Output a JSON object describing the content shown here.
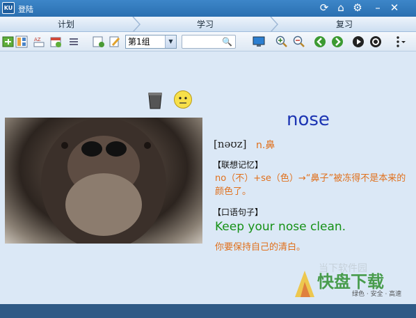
{
  "titlebar": {
    "logo": "KU",
    "title": "登陆",
    "icons": [
      "refresh-icon",
      "home-icon",
      "gear-icon",
      "minimize-icon",
      "close-icon"
    ]
  },
  "tabs": [
    {
      "label": "计划"
    },
    {
      "label": "学习"
    },
    {
      "label": "复习"
    }
  ],
  "toolbar": {
    "group_value": "第1组",
    "search_placeholder": ""
  },
  "card": {
    "word": "nose",
    "phonetic": "[nəʊz]",
    "pos": "n.鼻",
    "assoc_heading": "【联想记忆】",
    "assoc_text": "no（不）+se（色）→“鼻子”被冻得不是本来的颜色了。",
    "sentence_heading": "【口语句子】",
    "sentence_en": "Keep your nose clean.",
    "sentence_zh": "你要保持自己的清白。"
  },
  "watermark": {
    "main": "快盘下载",
    "tagline": "绿色 · 安全 · 高速",
    "faint": "当下软件园"
  },
  "colors": {
    "accent": "#1d35b3",
    "orange": "#e0701c",
    "green": "#169116",
    "titlebar": "#2a6fb0"
  }
}
